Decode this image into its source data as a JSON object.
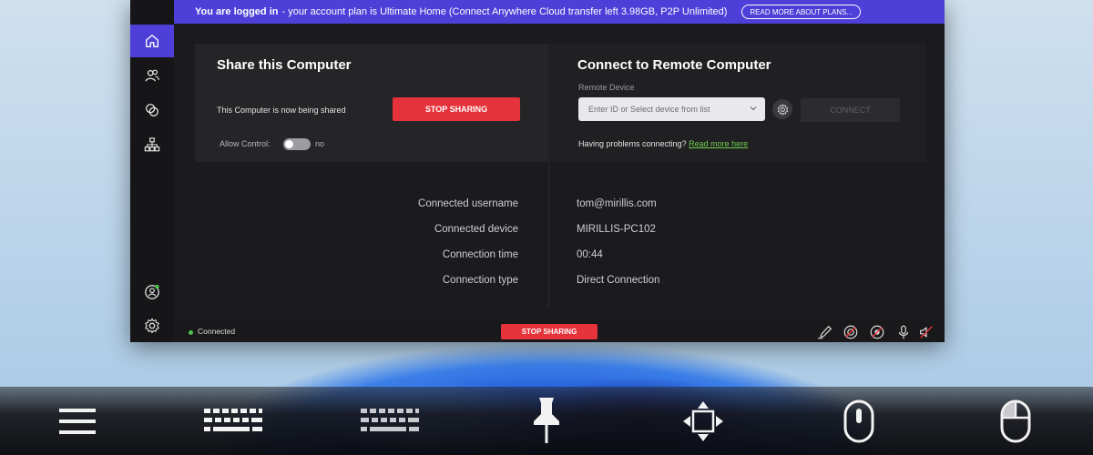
{
  "banner": {
    "logged_in": "You are logged in",
    "plan_text": " - your account plan is Ultimate Home (Connect Anywhere Cloud transfer left 3.98GB, P2P Unlimited)",
    "read_more_button": "READ MORE ABOUT PLANS..."
  },
  "sidebar": {
    "items": [
      {
        "icon": "home-icon",
        "active": true
      },
      {
        "icon": "users-icon",
        "active": false
      },
      {
        "icon": "overlap-circles-icon",
        "active": false
      },
      {
        "icon": "network-icon",
        "active": false
      }
    ],
    "bottom": [
      {
        "icon": "account-icon"
      },
      {
        "icon": "gear-icon"
      }
    ]
  },
  "share": {
    "title": "Share this Computer",
    "status": "This Computer is now being shared",
    "stop_button": "STOP SHARING",
    "allow_control_label": "Allow Control:",
    "allow_control_value": "no"
  },
  "connect": {
    "title": "Connect to Remote Computer",
    "remote_device_label": "Remote Device",
    "device_placeholder": "Enter ID or Select device from list",
    "connect_button": "CONNECT",
    "problems_text": "Having problems connecting?",
    "read_more_link": "Read more here"
  },
  "connection_info": {
    "labels": [
      "Connected username",
      "Connected device",
      "Connection time",
      "Connection type"
    ],
    "values": [
      "tom@mirillis.com",
      "MIRILLIS-PC102",
      "00:44",
      "Direct Connection"
    ]
  },
  "statusbar": {
    "status": "Connected",
    "stop_button": "STOP SHARING",
    "status_color": "#4ec34b",
    "icons": [
      "pen-icon",
      "target-icon",
      "record-icon",
      "microphone-icon",
      "speaker-muted-icon"
    ]
  },
  "toolbar": {
    "icons": [
      "menu-icon",
      "keyboard-icon",
      "keyboard-alt-icon",
      "pin-icon",
      "move-arrows-icon",
      "mouse-touch-icon",
      "mouse-icon"
    ]
  },
  "colors": {
    "accent": "#4d3fd8",
    "danger": "#e6323a",
    "link": "#6fcf4b"
  }
}
